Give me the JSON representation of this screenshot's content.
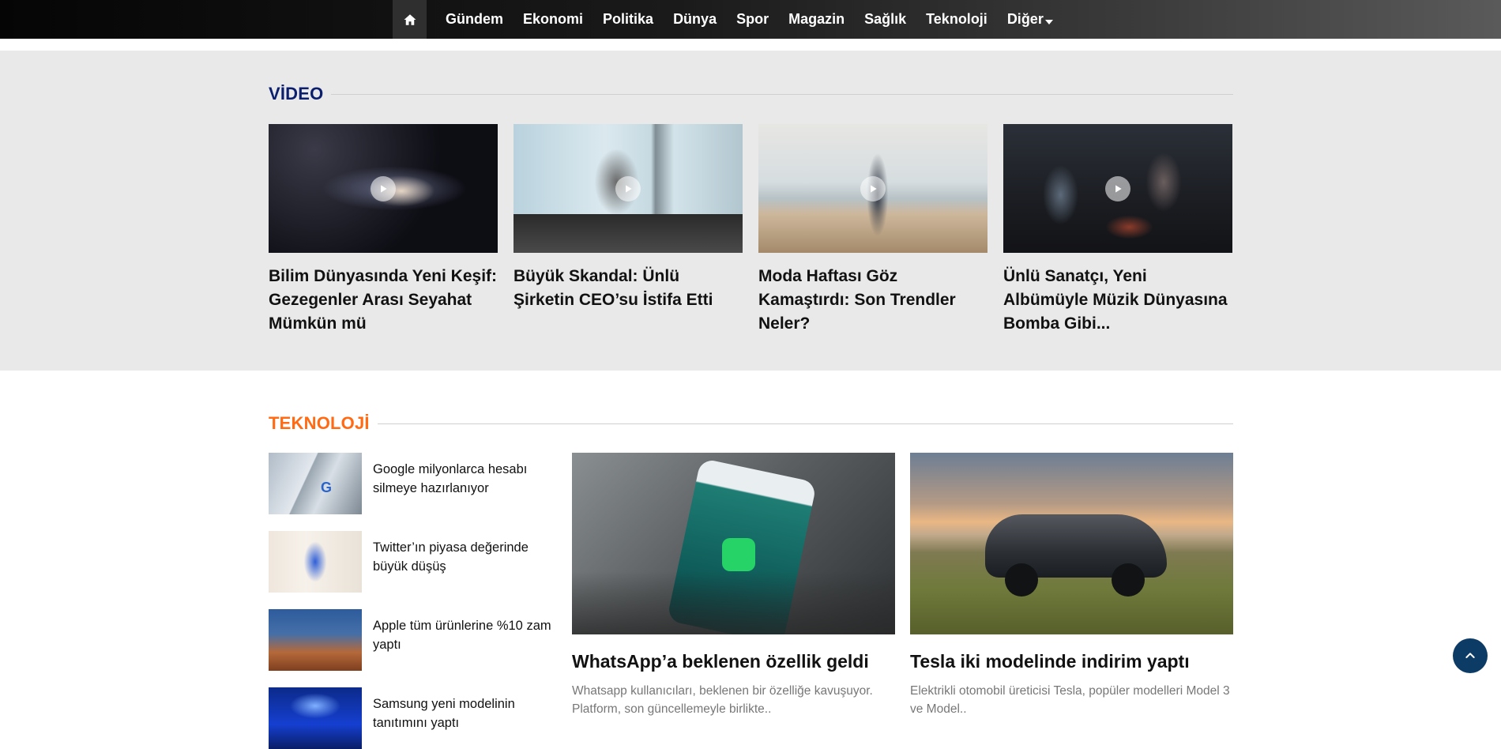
{
  "nav": {
    "home_icon": "home-icon",
    "items": [
      "Gündem",
      "Ekonomi",
      "Politika",
      "Dünya",
      "Spor",
      "Magazin",
      "Sağlık",
      "Teknoloji"
    ],
    "more_label": "Diğer",
    "more_icon": "caret-down-icon"
  },
  "video": {
    "title": "VİDEO",
    "cards": [
      {
        "title": "Bilim Dünyasında Yeni Keşif: Gezegenler Arası Seyahat Mümkün mü"
      },
      {
        "title": "Büyük Skandal: Ünlü Şirketin CEO’su İstifa Etti"
      },
      {
        "title": "Moda Haftası Göz Kamaştırdı: Son Trendler Neler?"
      },
      {
        "title": "Ünlü Sanatçı, Yeni Albümüyle Müzik Dünyasına Bomba Gibi..."
      }
    ]
  },
  "tech": {
    "title": "TEKNOLOJİ",
    "list": [
      {
        "title": "Google milyonlarca hesabı silmeye hazırlanıyor"
      },
      {
        "title": "Twitter’ın piyasa değerinde büyük düşüş"
      },
      {
        "title": "Apple tüm ürünlerine %10 zam yaptı"
      },
      {
        "title": "Samsung yeni modelinin tanıtımını yaptı"
      }
    ],
    "featured": [
      {
        "title": "WhatsApp’a beklenen özellik geldi",
        "desc": "Whatsapp kullanıcıları, beklenen bir özelliğe kavuşuyor. Platform, son güncellemeyle birlikte.."
      },
      {
        "title": "Tesla iki modelinde indirim yaptı",
        "desc": "Elektrikli otomobil üreticisi Tesla, popüler modelleri Model 3 ve Model.."
      }
    ]
  },
  "colors": {
    "video_title": "#0b1f6e",
    "tech_title": "#ff6a13",
    "back_to_top": "#0c3b66"
  }
}
